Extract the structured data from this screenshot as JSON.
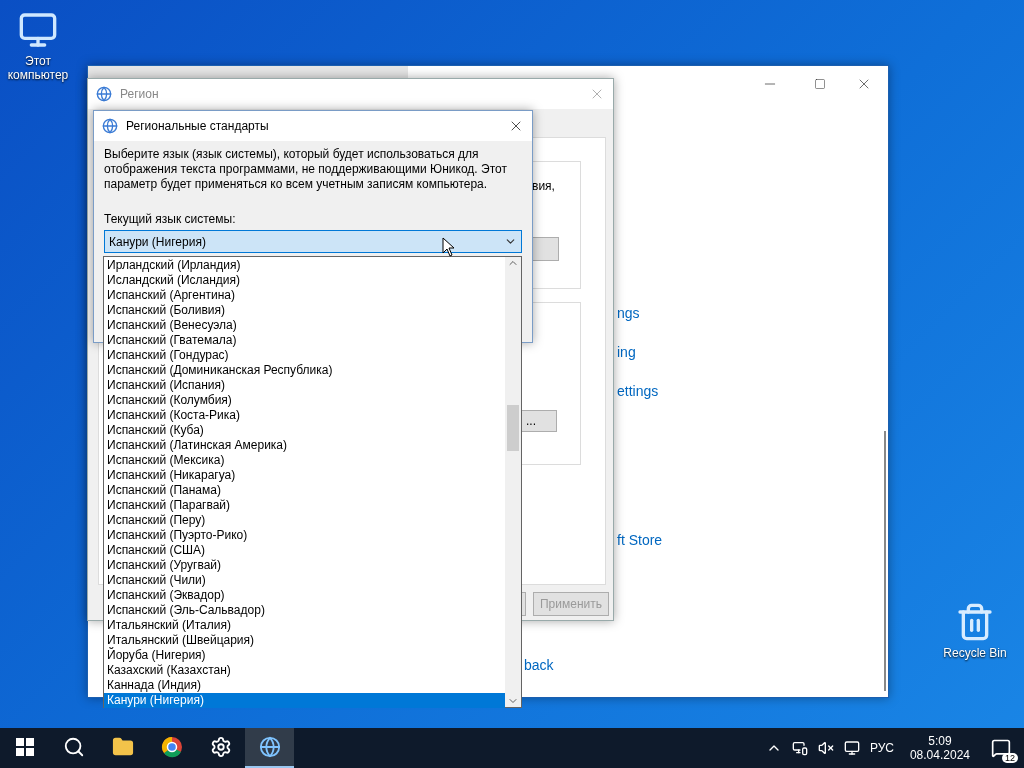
{
  "desktop_icons": [
    {
      "kind": "computer",
      "label": "Этот компьютер"
    },
    {
      "kind": "recycle",
      "label": "Recycle Bin"
    }
  ],
  "settings_window": {
    "links": [
      "ngs",
      "ing",
      "ettings",
      "ft Store",
      "back"
    ]
  },
  "region_window": {
    "title": "Регион",
    "fragment": "вия,",
    "copy_button": "...",
    "apply_button": {
      "label": "Применить",
      "disabled": true
    }
  },
  "dialog": {
    "title": "Региональные стандарты",
    "description": "Выберите язык (язык системы), который будет использоваться для отображения текста программами, не поддерживающими Юникод. Этот параметр будет применяться ко всем учетным записям компьютера.",
    "field_label": "Текущий язык системы:",
    "combo_value": "Канури (Нигерия)",
    "expanded": true,
    "options": [
      {
        "label": "Ирландский (Ирландия)",
        "selected": false
      },
      {
        "label": "Исландский (Исландия)",
        "selected": false
      },
      {
        "label": "Испанский (Аргентина)",
        "selected": false
      },
      {
        "label": "Испанский (Боливия)",
        "selected": false
      },
      {
        "label": "Испанский (Венесуэла)",
        "selected": false
      },
      {
        "label": "Испанский (Гватемала)",
        "selected": false
      },
      {
        "label": "Испанский (Гондурас)",
        "selected": false
      },
      {
        "label": "Испанский (Доминиканская Республика)",
        "selected": false
      },
      {
        "label": "Испанский (Испания)",
        "selected": false
      },
      {
        "label": "Испанский (Колумбия)",
        "selected": false
      },
      {
        "label": "Испанский (Коста-Рика)",
        "selected": false
      },
      {
        "label": "Испанский (Куба)",
        "selected": false
      },
      {
        "label": "Испанский (Латинская Америка)",
        "selected": false
      },
      {
        "label": "Испанский (Мексика)",
        "selected": false
      },
      {
        "label": "Испанский (Никарагуа)",
        "selected": false
      },
      {
        "label": "Испанский (Панама)",
        "selected": false
      },
      {
        "label": "Испанский (Парагвай)",
        "selected": false
      },
      {
        "label": "Испанский (Перу)",
        "selected": false
      },
      {
        "label": "Испанский (Пуэрто-Рико)",
        "selected": false
      },
      {
        "label": "Испанский (США)",
        "selected": false
      },
      {
        "label": "Испанский (Уругвай)",
        "selected": false
      },
      {
        "label": "Испанский (Чили)",
        "selected": false
      },
      {
        "label": "Испанский (Эквадор)",
        "selected": false
      },
      {
        "label": "Испанский (Эль-Сальвадор)",
        "selected": false
      },
      {
        "label": "Итальянский (Италия)",
        "selected": false
      },
      {
        "label": "Итальянский (Швейцария)",
        "selected": false
      },
      {
        "label": "Йоруба (Нигерия)",
        "selected": false
      },
      {
        "label": "Казахский (Казахстан)",
        "selected": false
      },
      {
        "label": "Каннада (Индия)",
        "selected": false
      },
      {
        "label": "Канури (Нигерия)",
        "selected": true
      }
    ]
  },
  "taskbar": {
    "apps": [
      {
        "kind": "explorer",
        "active": false
      },
      {
        "kind": "browser",
        "active": false
      },
      {
        "kind": "settings",
        "active": false
      },
      {
        "kind": "region",
        "active": true
      }
    ],
    "language": "РУС",
    "time": "5:09",
    "date": "08.04.2024",
    "notification_count": "12"
  }
}
